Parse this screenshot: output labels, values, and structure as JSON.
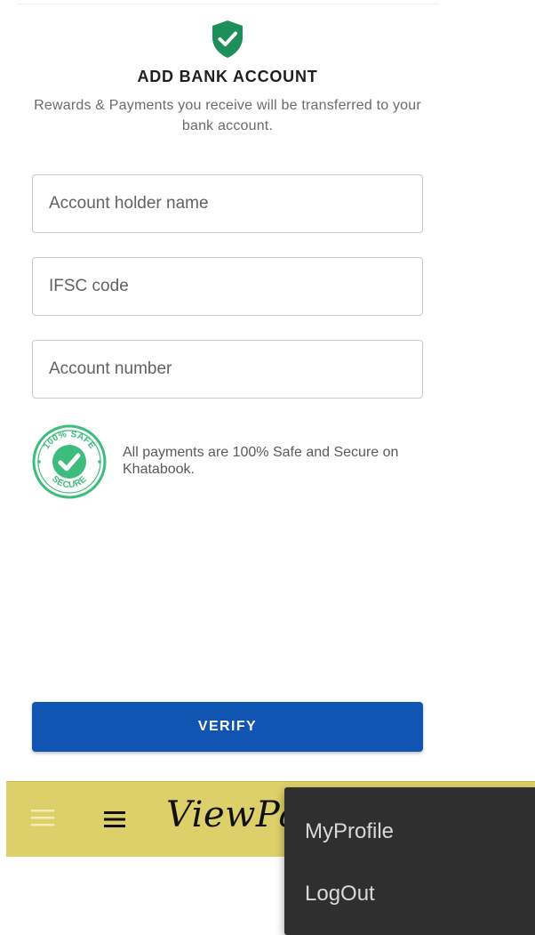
{
  "header": {
    "title": "ADD BANK ACCOUNT",
    "subtitle": "Rewards & Payments you receive will be transferred to your bank account."
  },
  "form": {
    "account_holder_placeholder": "Account holder name",
    "ifsc_placeholder": "IFSC code",
    "account_number_placeholder": "Account number"
  },
  "security": {
    "badge_icon": "safe-secure-badge-icon",
    "badge_text_top": "100% SAFE",
    "badge_text_bottom": "SECURE",
    "message": "All payments are 100% Safe and Secure on Khatabook."
  },
  "actions": {
    "verify_label": "VERIFY"
  },
  "appbar": {
    "logo": "ViewPay",
    "background": "#ddd06a"
  },
  "menu": {
    "items": [
      {
        "label": "MyProfile"
      },
      {
        "label": "LogOut"
      }
    ]
  },
  "colors": {
    "primary": "#1155b3",
    "accent_green": "#1e8e5a",
    "badge_green": "#3dbd7d"
  }
}
